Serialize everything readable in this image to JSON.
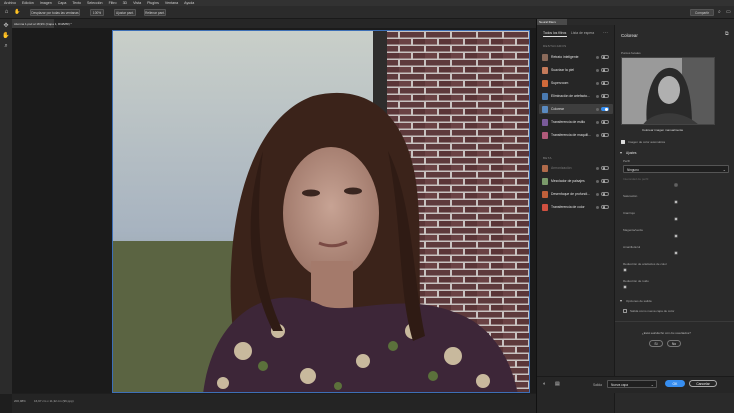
{
  "menubar": [
    "Archivo",
    "Edición",
    "Imagen",
    "Capa",
    "Texto",
    "Selección",
    "Filtro",
    "3D",
    "Vista",
    "Plugins",
    "Ventana",
    "Ayuda"
  ],
  "options": {
    "scroll_all": "Desplazar por todas las ventanas",
    "zoom": "100%",
    "fit_screen": "Ajustar pant.",
    "fill_screen": "Rellenar pant."
  },
  "topbar_share_label": "Compartir",
  "doc_tab": "Alumna 1.psd al 18,9% (Capa 1, RGB/8#) *",
  "status": {
    "zoom": "200,98%",
    "doc_info": "16,97 cm x 11,32 cm (96 ppp)"
  },
  "panel": {
    "header": "Neural filters",
    "tab_all": "Todos los filtros",
    "tab_waitlist": "Lista de espera",
    "section_featured": "DESTACADOS",
    "section_beta": "BETA",
    "featured": [
      {
        "label": "Retrato inteligente",
        "on": false
      },
      {
        "label": "Suavizar la piel",
        "on": false
      },
      {
        "label": "Superzoom",
        "on": false
      },
      {
        "label": "Eliminación de artefacto...",
        "on": false
      },
      {
        "label": "Colorear",
        "on": true
      },
      {
        "label": "Transferencia de estilo",
        "on": false
      },
      {
        "label": "Transferencia de maquill...",
        "on": false
      }
    ],
    "beta": [
      {
        "label": "Armonización",
        "on": false,
        "disabled": true
      },
      {
        "label": "Mezclador de paisajes",
        "on": false
      },
      {
        "label": "Desenfoque de profundi...",
        "on": false
      },
      {
        "label": "Transferencia de color",
        "on": false
      }
    ]
  },
  "settings": {
    "title": "Colorear",
    "preview_label": "Puntos focales",
    "preview_caption": "Colorear imagen manualmente",
    "auto_color_label": "Imagen de color automática",
    "adjustments_label": "Ajustes",
    "profile_label": "Perfil",
    "profile_value": "Ninguno",
    "sliders": [
      {
        "label": "Intensidad de perfil",
        "value": 0.5,
        "disabled": true,
        "color": "#555"
      },
      {
        "label": "Saturación",
        "value": 0.5,
        "color": "#b23"
      },
      {
        "label": "Cian/rojo",
        "value": 0.5,
        "color": "#c33"
      },
      {
        "label": "Magenta/verde",
        "value": 0.5,
        "color": "#3a5"
      },
      {
        "label": "Amarillo/azul",
        "value": 0.5,
        "color": "#35c"
      },
      {
        "label": "Reducción de artefactos de color",
        "value": 0.0,
        "color": "#666"
      },
      {
        "label": "Reducción de ruido",
        "value": 0.0,
        "color": "#666"
      }
    ],
    "output_options_label": "Opciones de salida",
    "output_new_layer_label": "Salida como nueva capa de color",
    "satisfied_question": "¿Está satisfecho con los resultados?",
    "yes_label": "Sí",
    "no_label": "No",
    "output_label": "Salida",
    "output_value": "Nueva capa",
    "ok_label": "OK",
    "cancel_label": "Cancelar"
  },
  "colors": {
    "accent": "#378ef0",
    "panel_bg": "#2a2a2a"
  }
}
